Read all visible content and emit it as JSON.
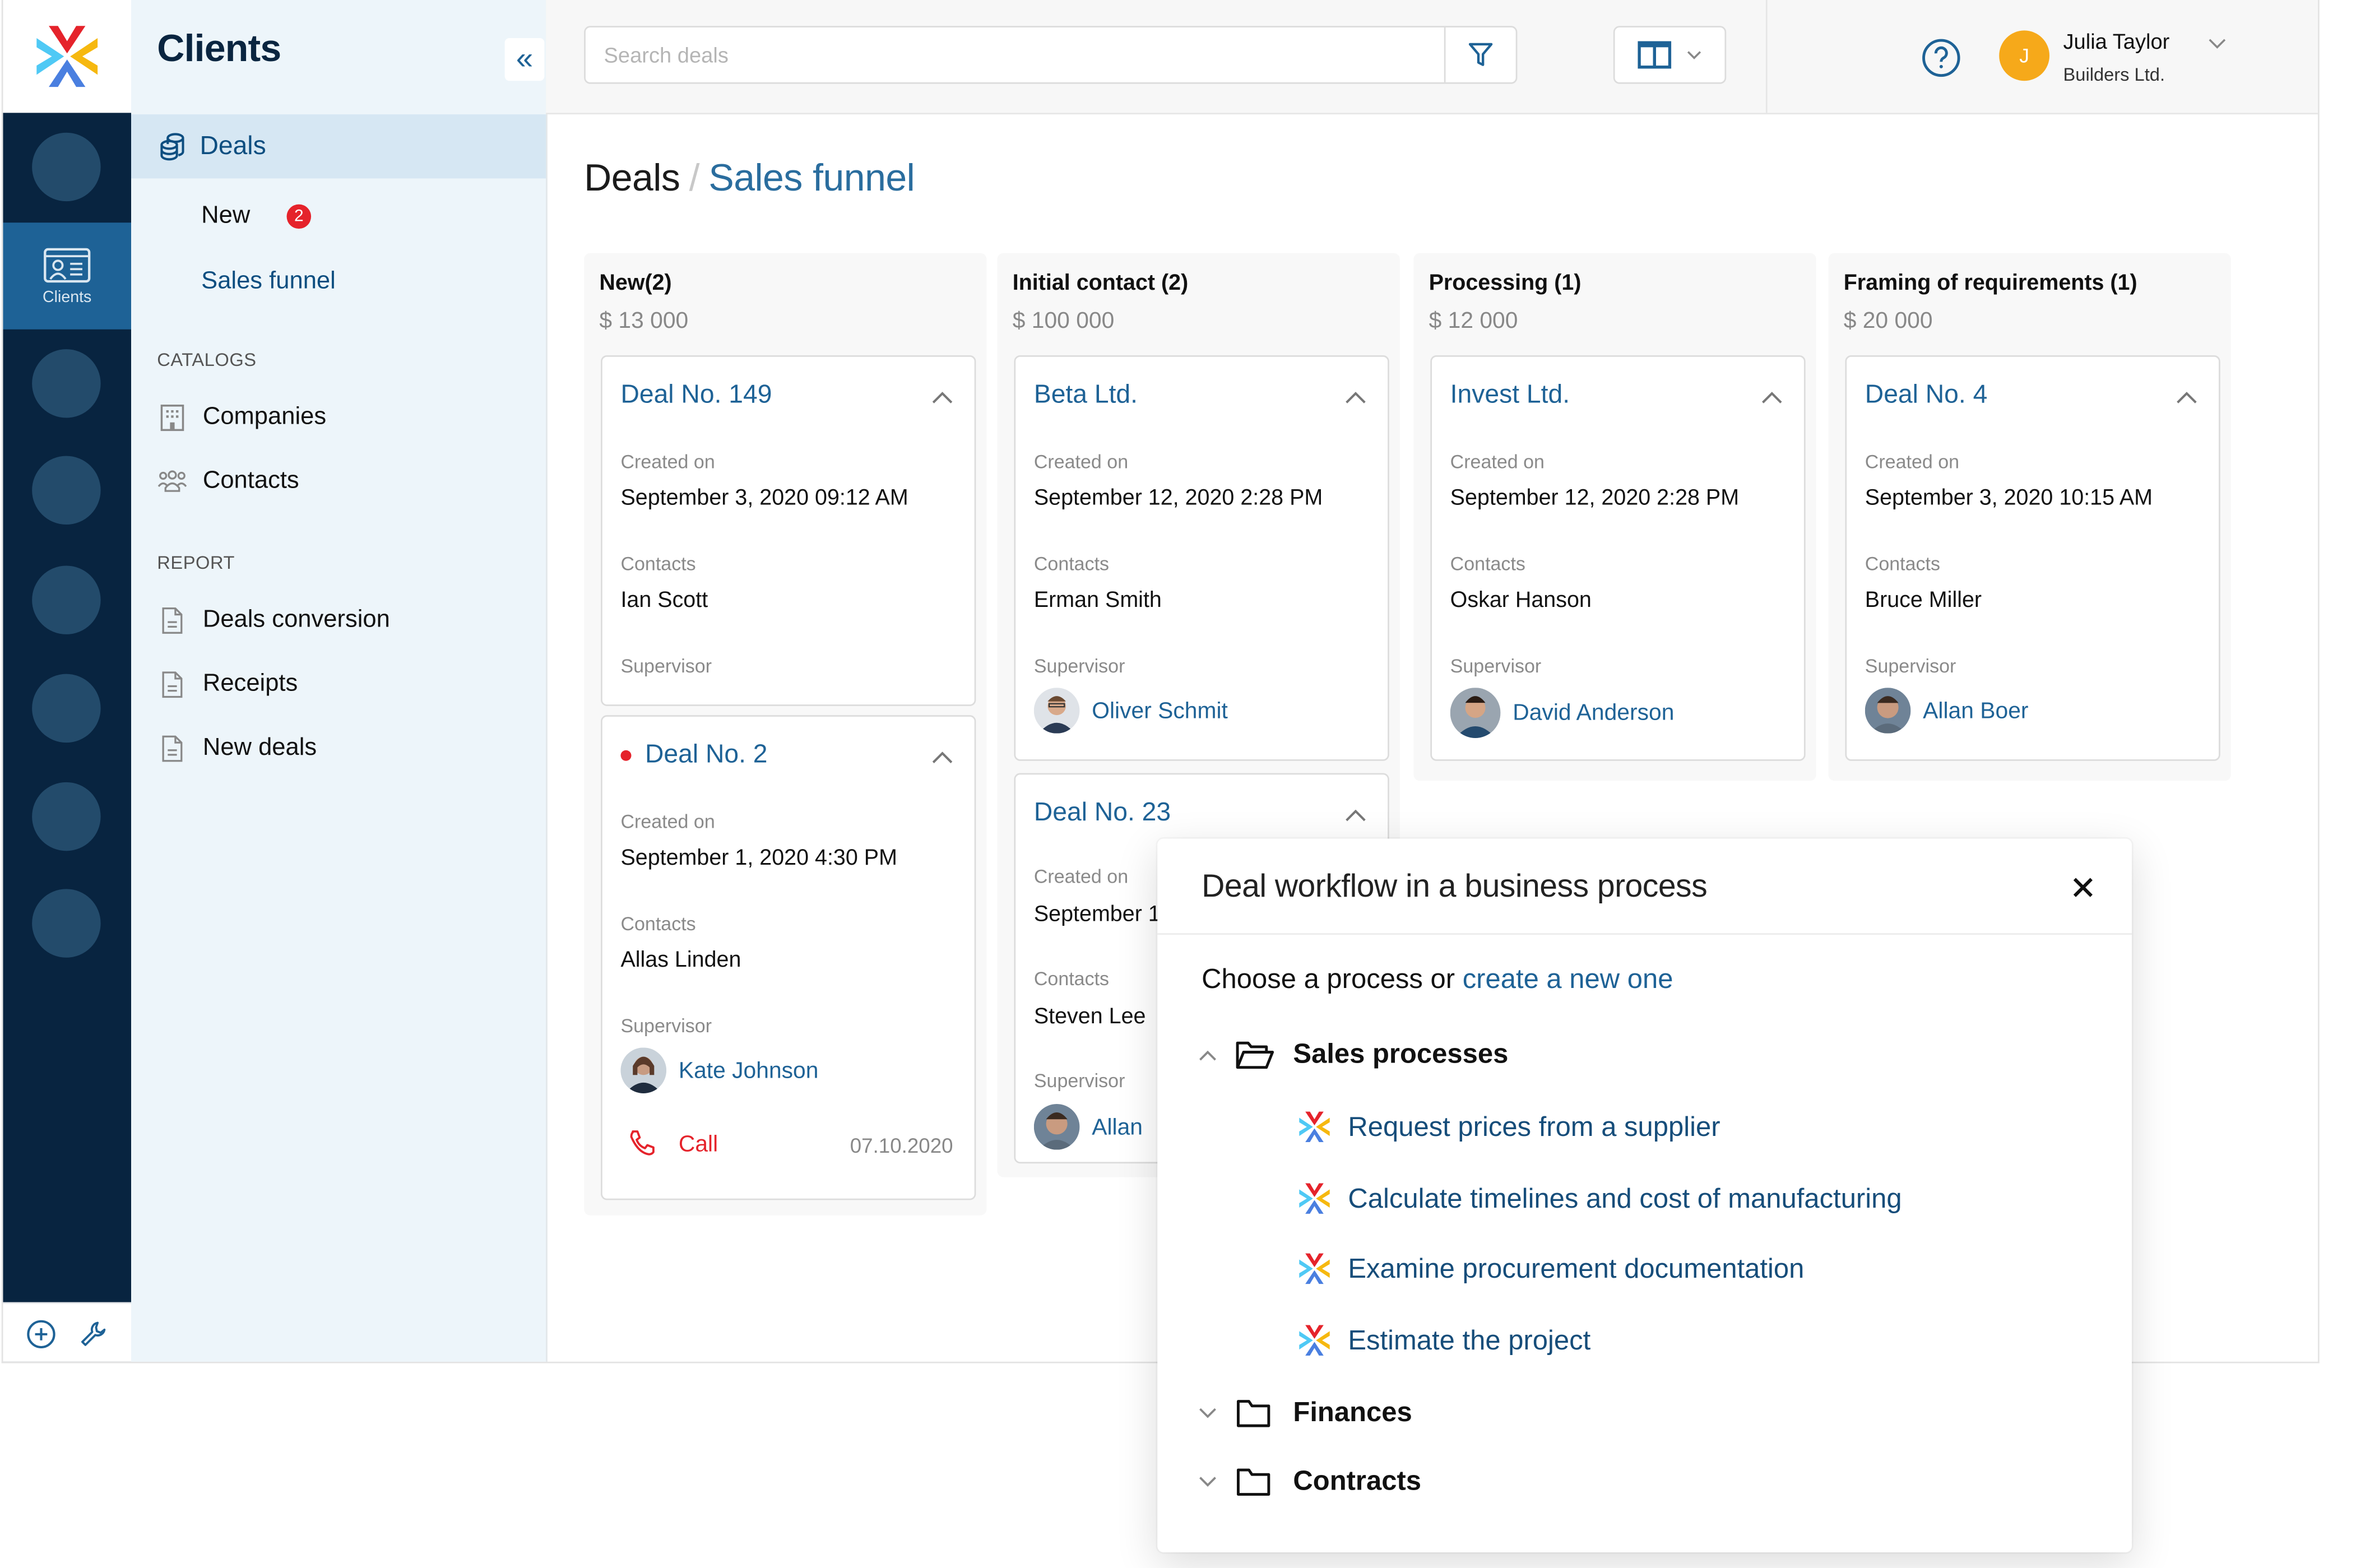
{
  "app": {
    "title": "Clients"
  },
  "rail": {
    "active_label": "Clients",
    "circle_count": 8
  },
  "nav": {
    "title": "Clients",
    "deals_label": "Deals",
    "sub_items": [
      {
        "label": "New",
        "badge": "2"
      },
      {
        "label": "Sales funnel"
      }
    ],
    "catalogs_heading": "CATALOGS",
    "catalogs": [
      {
        "label": "Companies",
        "icon": "building-icon"
      },
      {
        "label": "Contacts",
        "icon": "people-icon"
      }
    ],
    "report_heading": "REPORT",
    "reports": [
      {
        "label": "Deals conversion",
        "icon": "document-icon"
      },
      {
        "label": "Receipts",
        "icon": "document-icon"
      },
      {
        "label": "New deals",
        "icon": "document-icon"
      }
    ]
  },
  "topbar": {
    "search_placeholder": "Search deals",
    "search_value": "",
    "user": {
      "initial": "J",
      "name": "Julia Taylor",
      "company": "Builders Ltd."
    }
  },
  "breadcrumb": {
    "root": "Deals",
    "separator": "/",
    "current": "Sales funnel"
  },
  "columns": [
    {
      "title": "New(2)",
      "sum": "$ 13 000",
      "cards": [
        {
          "title": "Deal No. 149",
          "unread": false,
          "created_label": "Created on",
          "created": "September 3, 2020 09:12 AM",
          "contacts_label": "Contacts",
          "contact": "Ian Scott",
          "supervisor_label": "Supervisor",
          "supervisor": ""
        },
        {
          "title": "Deal No. 2",
          "unread": true,
          "created_label": "Created on",
          "created": "September 1, 2020 4:30 PM",
          "contacts_label": "Contacts",
          "contact": "Allas Linden",
          "supervisor_label": "Supervisor",
          "supervisor": "Kate Johnson",
          "action": "Call",
          "action_date": "07.10.2020"
        }
      ]
    },
    {
      "title": "Initial contact (2)",
      "sum": "$ 100 000",
      "cards": [
        {
          "title": "Beta Ltd.",
          "created_label": "Created on",
          "created": "September 12, 2020 2:28 PM",
          "contacts_label": "Contacts",
          "contact": "Erman Smith",
          "supervisor_label": "Supervisor",
          "supervisor": "Oliver Schmit"
        },
        {
          "title": "Deal No. 23",
          "created_label": "Created on",
          "created": "September 1",
          "contacts_label": "Contacts",
          "contact": "Steven Lee",
          "supervisor_label": "Supervisor",
          "supervisor": "Allan"
        }
      ]
    },
    {
      "title": "Processing (1)",
      "sum": "$ 12 000",
      "cards": [
        {
          "title": "Invest Ltd.",
          "created_label": "Created on",
          "created": "September 12, 2020 2:28 PM",
          "contacts_label": "Contacts",
          "contact": "Oskar Hanson",
          "supervisor_label": "Supervisor",
          "supervisor": "David Anderson"
        }
      ]
    },
    {
      "title": "Framing of requirements (1)",
      "sum": "$ 20 000",
      "cards": [
        {
          "title": "Deal No. 4",
          "created_label": "Created on",
          "created": "September 3, 2020 10:15 AM",
          "contacts_label": "Contacts",
          "contact": "Bruce  Miller",
          "supervisor_label": "Supervisor",
          "supervisor": "Allan Boer"
        }
      ]
    }
  ],
  "modal": {
    "title": "Deal workflow in a business process",
    "close": "✕",
    "choose_prefix": "Choose a process or ",
    "choose_link": "create a new one",
    "folders": [
      {
        "label": "Sales processes",
        "expanded": true,
        "items": [
          "Request prices from a supplier",
          "Calculate timelines and cost of manufacturing",
          "Examine procurement documentation",
          "Estimate the project"
        ]
      },
      {
        "label": "Finances",
        "expanded": false
      },
      {
        "label": "Contracts",
        "expanded": false
      }
    ]
  },
  "colors": {
    "brand_navy": "#082440",
    "accent_blue": "#1e6296",
    "rail_active": "#1e6296",
    "alert_red": "#e5232b",
    "user_avatar": "#f6a91a",
    "logo_red": "#e5232b",
    "logo_cyan": "#4fc9f5",
    "logo_yellow": "#f6b80f",
    "logo_blue": "#4a7fe0"
  }
}
